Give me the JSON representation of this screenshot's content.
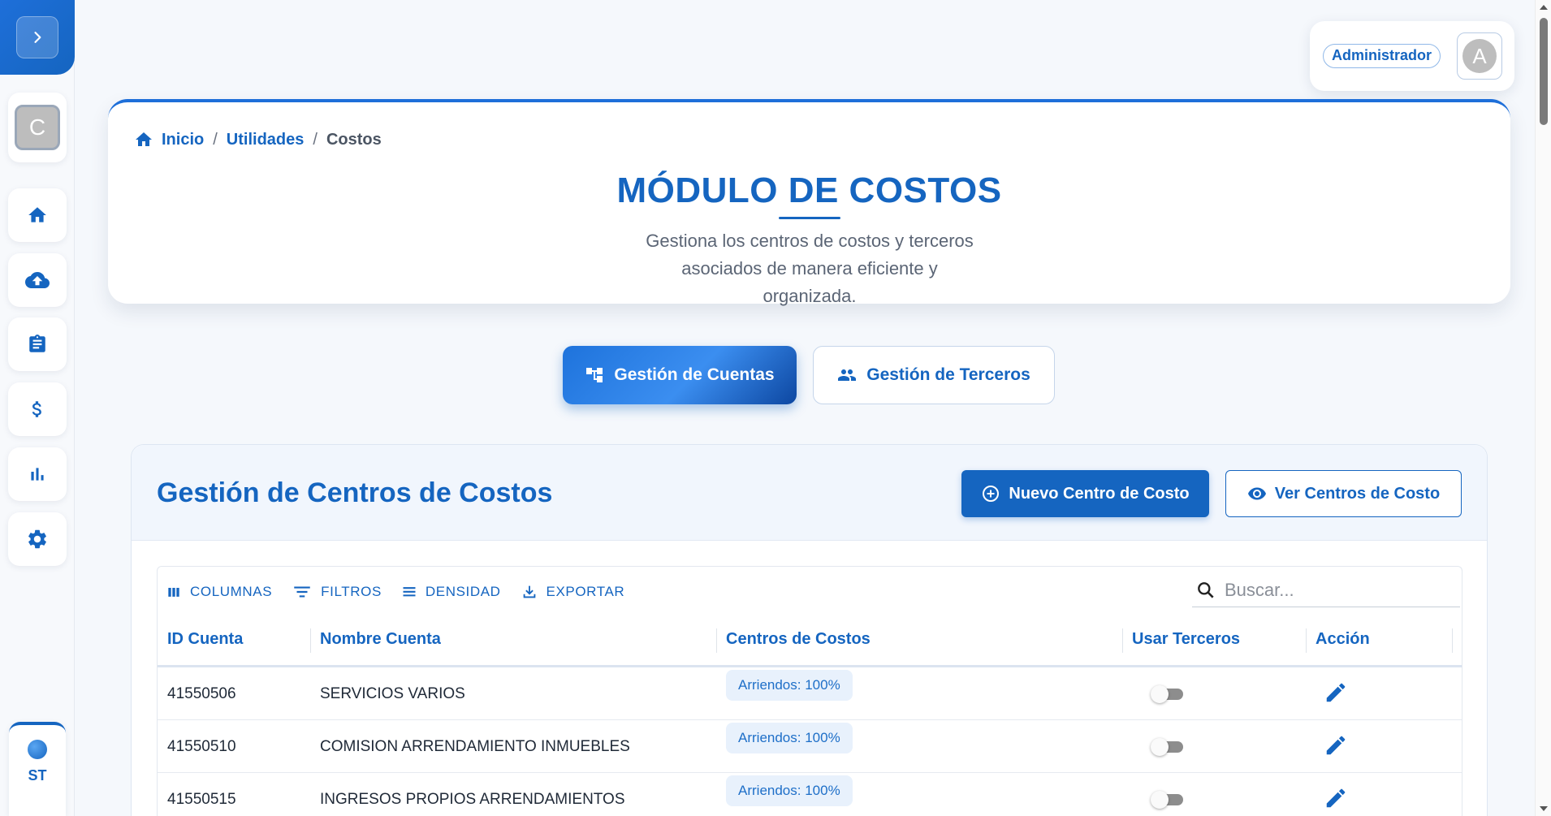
{
  "sidebar": {
    "company_initial": "C",
    "status_label": "ST"
  },
  "user": {
    "role": "Administrador",
    "avatar_initial": "A"
  },
  "breadcrumb": {
    "home": "Inicio",
    "section": "Utilidades",
    "current": "Costos"
  },
  "header": {
    "title": "MÓDULO DE COSTOS",
    "subtitle": "Gestiona los centros de costos y terceros asociados de manera eficiente y organizada."
  },
  "tabs": [
    {
      "label": "Gestión de Cuentas",
      "icon": "account-tree-icon",
      "active": true
    },
    {
      "label": "Gestión de Terceros",
      "icon": "people-icon",
      "active": false
    }
  ],
  "panel": {
    "title": "Gestión de Centros de Costos",
    "new_button": "Nuevo Centro de Costo",
    "view_button": "Ver Centros de Costo"
  },
  "toolbar": {
    "columns": "COLUMNAS",
    "filters": "FILTROS",
    "density": "DENSIDAD",
    "export": "EXPORTAR",
    "search_placeholder": "Buscar..."
  },
  "table": {
    "columns": [
      "ID Cuenta",
      "Nombre Cuenta",
      "Centros de Costos",
      "Usar Terceros",
      "Acción"
    ],
    "rows": [
      {
        "id": "41550506",
        "name": "SERVICIOS VARIOS",
        "centers": "Arriendos: 100%",
        "use_third_parties": false
      },
      {
        "id": "41550510",
        "name": "COMISION ARRENDAMIENTO INMUEBLES",
        "centers": "Arriendos: 100%",
        "use_third_parties": false
      },
      {
        "id": "41550515",
        "name": "INGRESOS PROPIOS ARRENDAMIENTOS",
        "centers": "Arriendos: 100%",
        "use_third_parties": false
      }
    ]
  },
  "colors": {
    "primary": "#1565c0",
    "chip_bg": "#e8f1fc"
  }
}
